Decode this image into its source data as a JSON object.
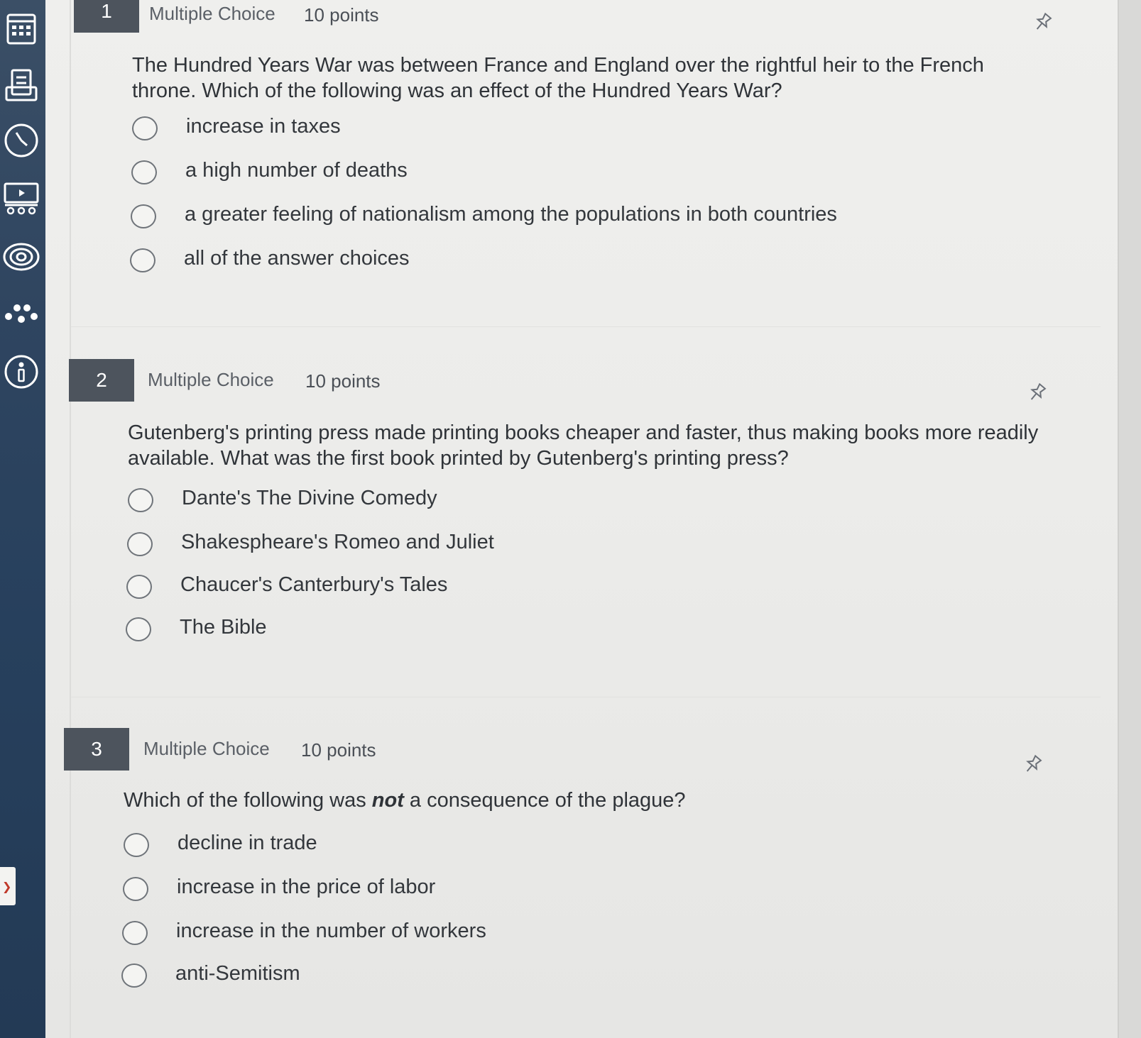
{
  "nav": {
    "items": [
      {
        "name": "calendar-icon",
        "label": "Calendar"
      },
      {
        "name": "inbox-icon",
        "label": "Inbox"
      },
      {
        "name": "history-icon",
        "label": "History"
      },
      {
        "name": "studio-icon",
        "label": "Studio"
      },
      {
        "name": "swirl-icon",
        "label": "Commons"
      },
      {
        "name": "people-icon",
        "label": "People"
      },
      {
        "name": "info-icon",
        "label": "Help"
      }
    ],
    "tab_glyph": "❯"
  },
  "questions": [
    {
      "number": "1",
      "type": "Multiple Choice",
      "points": "10 points",
      "text": "The Hundred Years War was between France and England over the rightful heir to the French throne. Which of the following was an effect of the Hundred Years War?",
      "answers": [
        "increase in taxes",
        "a high number of deaths",
        "a greater feeling of nationalism among the populations in both countries",
        "all of the answer choices"
      ]
    },
    {
      "number": "2",
      "type": "Multiple Choice",
      "points": "10 points",
      "text": "Gutenberg's printing press made printing books cheaper and faster, thus making books more readily available. What was the first book printed by Gutenberg's printing press?",
      "answers": [
        "Dante's The Divine Comedy",
        "Shakespheare's Romeo and Juliet",
        "Chaucer's Canterbury's Tales",
        "The Bible"
      ]
    },
    {
      "number": "3",
      "type": "Multiple Choice",
      "points": "10 points",
      "text_before": "Which of the following was ",
      "text_emphasis": "not",
      "text_after": " a consequence of the plague?",
      "answers": [
        "decline in trade",
        "increase in the price of labor",
        "increase in the number of workers",
        "anti-Semitism"
      ]
    }
  ],
  "colors": {
    "nav_bg": "#2f4560",
    "number_badge": "#4d545d",
    "page_bg": "#ececea",
    "text": "#2f3338"
  }
}
